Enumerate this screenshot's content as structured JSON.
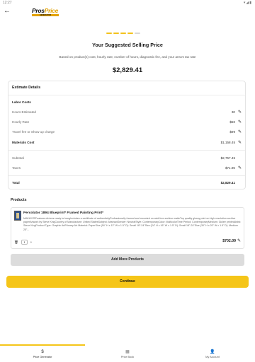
{
  "status": {
    "time": "12:27",
    "icons": "▾◢▮"
  },
  "logo": {
    "part1": "Pros",
    "part2": "Price",
    "tagline": "GENERATOR"
  },
  "progress": {
    "steps": 5,
    "completed": 4
  },
  "header": {
    "title": "Your Suggested Selling Price",
    "subtitle": "Based on product(s) cost, hourly rate, number of hours, diagnostic fee, and your area's tax rate",
    "price": "$2,829.41"
  },
  "estimate": {
    "title": "Estimate Details",
    "labor_costs_label": "Labor Costs",
    "hours_label": "Hours Estimated",
    "hours_value": "30",
    "rate_label": "Hourly Rate",
    "rate_value": "$50",
    "travel_label": "Travel fee or Show up charge",
    "travel_value": "$99",
    "materials_label": "Materials Cost",
    "materials_value": "$1,158.45",
    "subtotal_label": "Subtotal",
    "subtotal_value": "$2,757.45",
    "taxes_label": "Taxes",
    "taxes_value": "$71.96",
    "total_label": "Total",
    "total_value": "$2,829.41"
  },
  "products": {
    "label": "Products",
    "items": [
      {
        "name": "Percolator 1894 Blueprint* Framed Painting Print*",
        "description": "MAKAYZEFeatures:Arrives ready to hangIncludes a certificate of authenticityProfessionally framed and mounted on acid free archive matteTop quality glossy print on high resolution archive paperArtwork by Steve KingCountry of Manufacture: United StatesSubject: AbstractGender: NeutralStyle: ContemporaryColor: MulticolorTime Period: ContemporaryMedium: Giclee printedArtist: Steve KingProduct Type: Graphic ArtPrimary Art Material: PaperSize (16\" H x 12\" W x 1.5\" D): Small 18\"-24\"Size (24\" H x 16\" W x 1.5\" D): Small 18\"-24\"Size (30\" H x 20\" W x 1.5\" D): Medium 25\"...",
        "quantity": "1",
        "price": "$702.09"
      }
    ]
  },
  "buttons": {
    "add_more": "Add More Products",
    "continue": "Continue"
  },
  "tabs": [
    {
      "label": "Price Generator",
      "icon": "$"
    },
    {
      "label": "Price Book",
      "icon": "▦"
    },
    {
      "label": "My Account",
      "icon": "👤"
    }
  ]
}
